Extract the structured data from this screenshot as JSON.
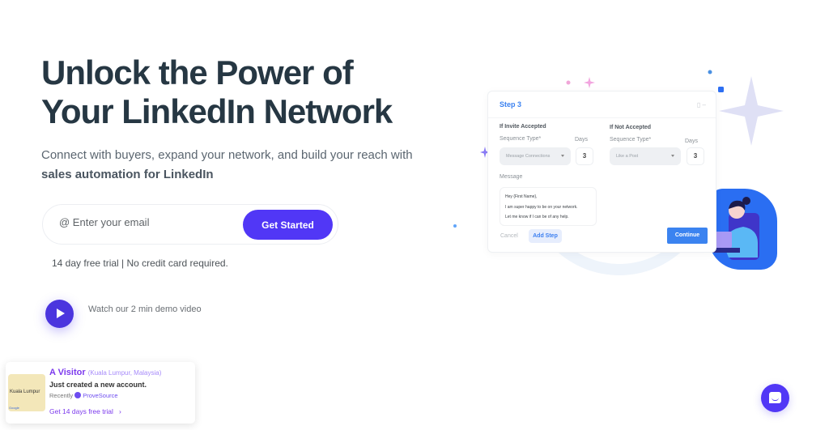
{
  "hero": {
    "title_line1": "Unlock the Power of",
    "title_line2": "Your LinkedIn Network",
    "subtitle_plain": "Connect with buyers, expand your network, and build your reach with ",
    "subtitle_bold": "sales automation for LinkedIn"
  },
  "signup": {
    "email_placeholder": "@ Enter your email",
    "email_value": "",
    "cta_label": "Get Started",
    "trial_note": "14 day free trial | No credit card required."
  },
  "demo": {
    "icon": "play-icon",
    "label": "Watch our 2 min demo video"
  },
  "step_card": {
    "title": "Step 3",
    "icons": [
      "copy-icon",
      "minus-icon"
    ],
    "accepted": {
      "heading": "If Invite Accepted",
      "sequence_label": "Sequence Type*",
      "sequence_value": "Message Connections",
      "days_label": "Days",
      "days_value": "3"
    },
    "not_accepted": {
      "heading": "If Not Accepted",
      "sequence_label": "Sequence Type*",
      "sequence_value": "Like a Post",
      "days_label": "Days",
      "days_value": "3"
    },
    "message_label": "Message",
    "message_lines": [
      "Hey {First Name},",
      "I am super happy to be on your network.",
      "Let me know if I can be of any help."
    ],
    "cancel_label": "Cancel",
    "add_step_label": "Add Step",
    "continue_label": "Continue"
  },
  "notification": {
    "name": "A Visitor",
    "location": "(Kuala Lumpur, Malaysia)",
    "action": "Just created a new account.",
    "time": "Recently",
    "brand": "ProveSource",
    "cta": "Get 14 days free trial",
    "map_label": "Kuala Lumpur",
    "map_credit": "Google"
  },
  "chat": {
    "icon": "chat-icon"
  },
  "colors": {
    "primary": "#5137f6",
    "heading": "#263743",
    "card_accent": "#3b83f0",
    "notif_accent": "#7c3aed"
  }
}
